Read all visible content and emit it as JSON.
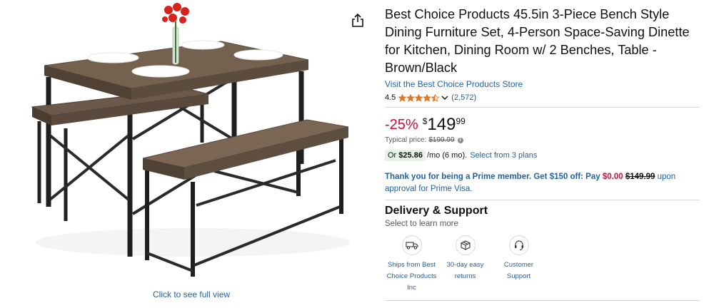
{
  "product": {
    "title": "Best Choice Products 45.5in 3-Piece Bench Style Dining Furniture Set, 4-Person Space-Saving Dinette for Kitchen, Dining Room w/ 2 Benches, Table - Brown/Black",
    "store_link": "Visit the Best Choice Products Store",
    "rating_value": "4.5",
    "rating_stars": 4.5,
    "rating_count": "(2,572)"
  },
  "price": {
    "discount": "-25%",
    "currency_symbol": "$",
    "whole": "149",
    "fraction": "99",
    "typical_label": "Typical price:",
    "typical_value": "$199.99"
  },
  "monthly": {
    "or_label": "Or",
    "amount": "$25.86",
    "term": "/mo (6 mo).",
    "plans_link": "Select from 3 plans"
  },
  "prime": {
    "prefix": "Thank you for being a Prime member. Get $150 off: Pay",
    "pay_amount": "$0.00",
    "strike_amount": "$149.99",
    "suffix": "upon approval for Prime Visa."
  },
  "delivery": {
    "title": "Delivery & Support",
    "subtitle": "Select to learn more",
    "items": [
      {
        "label": "Ships from Best Choice Products Inc",
        "icon": "truck-icon"
      },
      {
        "label": "30-day easy returns",
        "icon": "returns-box-icon"
      },
      {
        "label": "Customer Support",
        "icon": "headset-icon"
      }
    ]
  },
  "image": {
    "see_full_label": "Click to see full view"
  },
  "colors": {
    "link": "#2162a1",
    "discount_red": "#cc0c39",
    "star_orange": "#de7921",
    "badge_green": "#e3f4e6"
  }
}
